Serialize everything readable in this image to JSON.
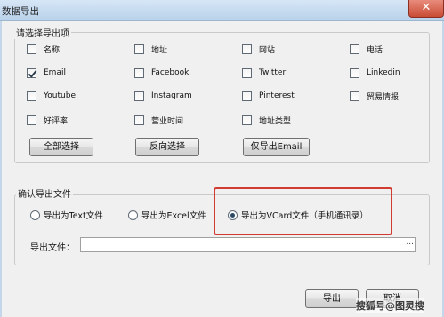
{
  "window": {
    "title": "数据导出",
    "close_glyph": "✕"
  },
  "fields_group": {
    "legend": "请选择导出项",
    "checkboxes": [
      {
        "label": "名称",
        "checked": false
      },
      {
        "label": "地址",
        "checked": false
      },
      {
        "label": "网站",
        "checked": false
      },
      {
        "label": "电话",
        "checked": false
      },
      {
        "label": "Email",
        "checked": true
      },
      {
        "label": "Facebook",
        "checked": false
      },
      {
        "label": "Twitter",
        "checked": false
      },
      {
        "label": "Linkedin",
        "checked": false
      },
      {
        "label": "Youtube",
        "checked": false
      },
      {
        "label": "Instagram",
        "checked": false
      },
      {
        "label": "Pinterest",
        "checked": false
      },
      {
        "label": "贸易情报",
        "checked": false
      },
      {
        "label": "好评率",
        "checked": false
      },
      {
        "label": "营业时间",
        "checked": false
      },
      {
        "label": "地址类型",
        "checked": false
      }
    ],
    "select_all_label": "全部选择",
    "invert_selection_label": "反向选择",
    "email_only_label": "仅导出Email"
  },
  "export_group": {
    "legend": "确认导出文件",
    "radio_text": "导出为Text文件",
    "radio_excel": "导出为Excel文件",
    "radio_vcard": "导出为VCard文件（手机通讯录）",
    "selected": "vcard",
    "file_label": "导出文件：",
    "file_value": "",
    "browse_label": "..."
  },
  "footer": {
    "export_label": "导出",
    "cancel_label": "取消"
  },
  "watermark": "搜狐号@图灵搜",
  "colors": {
    "highlight": "#d23b32",
    "titlebar": "#c9dcef"
  }
}
